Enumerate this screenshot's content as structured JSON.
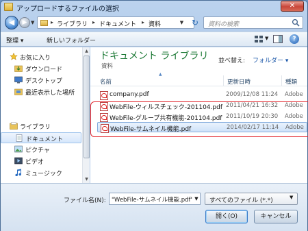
{
  "window": {
    "title": "アップロードするファイルの選択",
    "close_glyph": "✕"
  },
  "address": {
    "crumbs": [
      "ライブラリ",
      "ドキュメント",
      "資料"
    ],
    "separator": "▸",
    "search_placeholder": "資料の検索"
  },
  "toolbar": {
    "organize": "整理 ▾",
    "new_folder": "新しいフォルダー"
  },
  "nav": {
    "favorites": {
      "label": "お気に入り",
      "items": [
        "ダウンロード",
        "デスクトップ",
        "最近表示した場所"
      ]
    },
    "libraries": {
      "label": "ライブラリ",
      "items": [
        "ドキュメント",
        "ピクチャ",
        "ビデオ",
        "ミュージック"
      ]
    },
    "selected": "ドキュメント"
  },
  "library": {
    "title": "ドキュメント ライブラリ",
    "subtitle": "資料",
    "arrange_label": "並べ替え:",
    "arrange_value": "フォルダー ▾"
  },
  "columns": {
    "name": "名前",
    "date": "更新日時",
    "type": "種類"
  },
  "files": [
    {
      "name": "company.pdf",
      "date": "2009/12/08 11:24",
      "type": "Adobe"
    },
    {
      "name": "WebFile-ウィルスチェック-201104.pdf",
      "date": "2011/04/21 16:32",
      "type": "Adobe"
    },
    {
      "name": "WebFile-グループ共有機能-201104.pdf",
      "date": "2011/10/19 20:30",
      "type": "Adobe"
    },
    {
      "name": "WebFile-サムネイル機能.pdf",
      "date": "2014/02/17 11:14",
      "type": "Adobe"
    }
  ],
  "selected_file_index": 3,
  "bottom": {
    "filename_label": "ファイル名(N):",
    "filename_value": "\"WebFile-サムネイル機能.pdf\"",
    "filter_value": "すべてのファイル (*.*)",
    "open_label": "開く(O)",
    "cancel_label": "キャンセル"
  },
  "colors": {
    "library_title": "#1e7a37",
    "highlight_box": "#e2232a",
    "link": "#1b57a9"
  }
}
